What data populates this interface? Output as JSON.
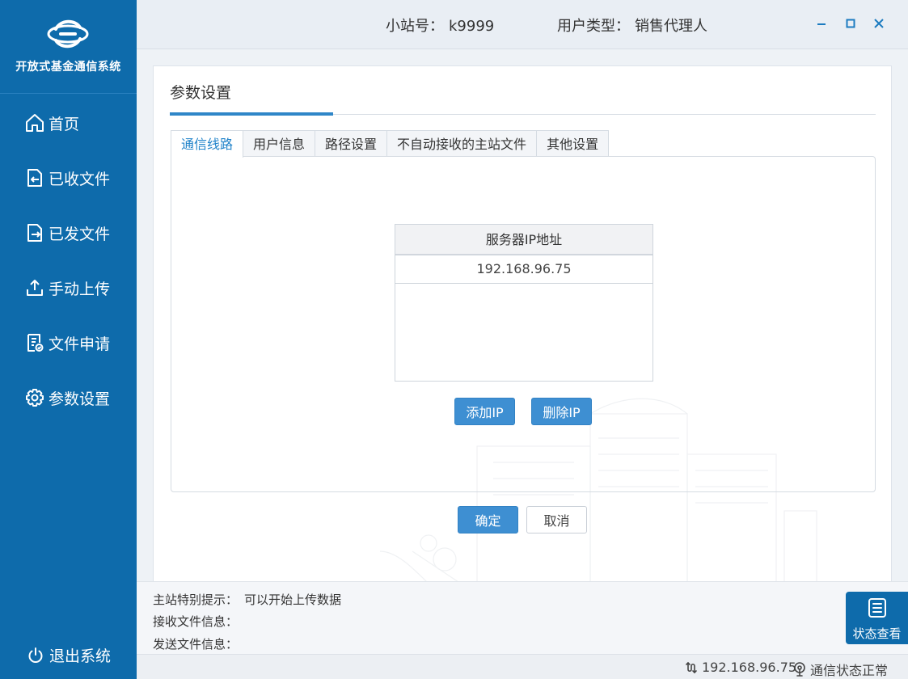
{
  "app": {
    "name": "开放式基金通信系统"
  },
  "sidebar": {
    "items": [
      {
        "label": "首页",
        "icon": "home-icon"
      },
      {
        "label": "已收文件",
        "icon": "received-file-icon"
      },
      {
        "label": "已发文件",
        "icon": "sent-file-icon"
      },
      {
        "label": "手动上传",
        "icon": "upload-icon"
      },
      {
        "label": "文件申请",
        "icon": "file-request-icon"
      },
      {
        "label": "参数设置",
        "icon": "gear-icon"
      }
    ],
    "logout_label": "退出系统"
  },
  "header": {
    "station_label": "小站号：",
    "station_value": "k9999",
    "usertype_label": "用户类型：",
    "usertype_value": "销售代理人"
  },
  "panel": {
    "title": "参数设置",
    "tabs": [
      {
        "label": "通信线路",
        "active": true
      },
      {
        "label": "用户信息",
        "active": false
      },
      {
        "label": "路径设置",
        "active": false
      },
      {
        "label": "不自动接收的主站文件",
        "active": false
      },
      {
        "label": "其他设置",
        "active": false
      }
    ],
    "ip_table": {
      "header": "服务器IP地址",
      "rows": [
        "192.168.96.75"
      ]
    },
    "add_ip_label": "添加IP",
    "delete_ip_label": "删除IP",
    "confirm_label": "确定",
    "cancel_label": "取消"
  },
  "info": {
    "notice_label": "主站特别提示：",
    "notice_value": "可以开始上传数据",
    "receive_label": "接收文件信息：",
    "send_label": "发送文件信息："
  },
  "status_button_label": "状态查看",
  "statusbar": {
    "ip": "192.168.96.75",
    "state": "通信状态正常"
  },
  "colors": {
    "sidebar": "#0e6bab",
    "accent": "#2f86c8",
    "primary_button": "#3e8fd2"
  }
}
